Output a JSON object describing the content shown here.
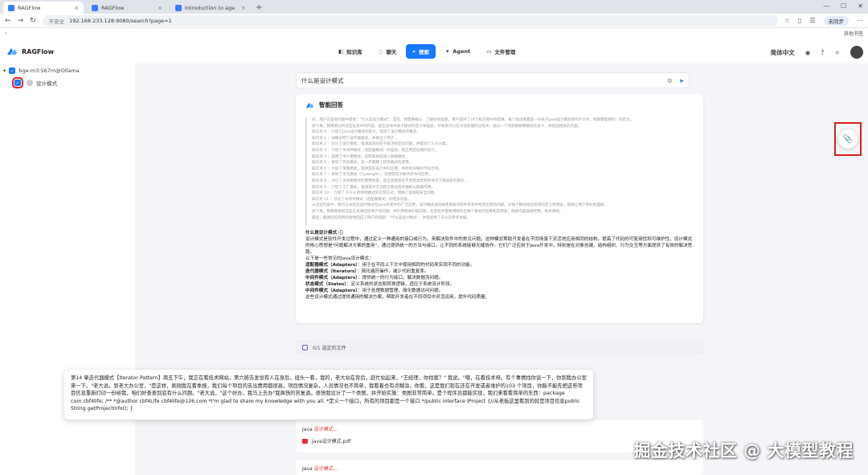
{
  "browser": {
    "tabs": [
      {
        "label": "RAGFlow",
        "active": true
      },
      {
        "label": "RAGFlow",
        "active": false
      },
      {
        "label": "Introduction to age",
        "active": false
      }
    ],
    "new_tab": "+",
    "url_warning": "不安全",
    "url": "192.168.233.128:9080/search?page=1",
    "profile_label": "未同步",
    "bookmarks_label": "其他书签"
  },
  "app": {
    "name": "RAGFlow",
    "nav": [
      {
        "label": "知识库",
        "active": false
      },
      {
        "label": "聊天",
        "active": false
      },
      {
        "label": "搜索",
        "active": true
      },
      {
        "label": "Agent",
        "active": false
      },
      {
        "label": "文件管理",
        "active": false
      }
    ],
    "language": "简体中文"
  },
  "sidebar": {
    "kb_label": "bge-m3:567m@Ollama",
    "doc_label": "设计模式"
  },
  "search": {
    "query": "什么是设计模式"
  },
  "answer": {
    "title": "智能回答",
    "thinking": [
      "好，用户在查询问题中提到：\"什么是设计模式\"。首先，我需要确认 · 了解好的指南。用户提供了24个知识库中的结果，每个知识库都是一份关于Java设计模式的PDF文件，标题都是相同 · 的结论。",
      "接下来，我需要分析这些信息中的内容，提出总体中关于模式的定义和描述。开发者可以在对话处理的过程中，通过一个问题来解释模式的含义，并给出相关的内容。",
      "知识点 0 ：介绍了Java设计模式的定义，提到了设计模式的概念。",
      "知识点 1 ：详细说明了迭代器模式，并举出了例子 。",
      "知识点 2 ：讨论了设计模式，强调其目的在于解决特定的问题，并提到了三大分类。",
      "知识点 3 ：介绍了中间件模式（适配器模式）的描述，其应用是后期的设计。",
      "知识点 4 ：说明了中介者模式，说明其如何减少依赖耦合。",
      "知识点 5 ：讲述了状态模式，说一步解释了状态模式的使用。",
      "知识点 6 ：介绍了策略模式，提供其在设计中的应用，并附有详细的代码示例。",
      "知识点 7 ：讲到了享元模式（Flyweight），说明其在对象共享中的应用 。",
      "知识点 8 ：讨论了访问者模式的使用场景，提出其能够在不改变类结构的情况下增加新的操作 。",
      "知识点 9 ：介绍了工厂模式，强调其对于创建对象过程的抽象与解耦作用。",
      "知识点 10 ：介绍了 0-0-0 的单例模式的实现方式，明确了其线程安全问题。",
      "知识点 11 ：讨论了中间件模式（适配器模式）的相关内容。",
      "从这些内容中，我可以总结出设计模式在Java开发中的广泛应用，设计模式通常被用来解决软件开发中经常出现的问题。对每个模式给出简单的定义和用途，能够让用户更好地理解。",
      "接下来，我需要组织这些信息来回答用户的问题，并引用相关的知识库。在回答中需要明确列出每个模式的名称和其用途，确保内容准确完整，格式清晰。",
      "最后，确保回答简明扼要地回应了用户的问题：\"什么是设计模式\"，并且提供了充分的参考依据。"
    ],
    "heading": "什么是设计模式",
    "intro": "设计模式是软件开发过程中，通过定义一种通用的接口或行为，来解决软件中的常见问题。这种模式帮助开发者在不同场景下灵活地应用相同的结构，提高了代码的可复用性和可维护性。设计模式的核心思想是\"问题解决方案的重用\"，通过提供统一的方法与接口，让不同的系统能够无缝协作。它们广泛应用于Java开发中，特别是在对象创建、结构组织、行为交互等方面提供了有效的解决思路。",
    "list_intro": "以下是一些常见的Java设计模式：",
    "items": [
      {
        "name": "适配器模式（Adapters）",
        "desc": "：用于在不同上下文中使用相同的代码来实现不同的功能。"
      },
      {
        "name": "迭代器模式（Iterators）",
        "desc": "：简化遍历操作，减少代码重复率。"
      },
      {
        "name": "中间件模式（Adapters）",
        "desc": "：提供统一的行为接口，解决数据流问题。"
      },
      {
        "name": "状态模式（States）",
        "desc": "：定义系统的状态和转换逻辑，适应于系统设计阶段。"
      },
      {
        "name": "中间件模式（Adapters）",
        "desc": "：用于处理数据管理，简化数据访问问题。"
      }
    ],
    "summary": "这些设计模式通过提供通用的解决方案，帮助开发者在不同项目中灵活运用，提升代码质量。"
  },
  "files_bar": {
    "label": "0/1 选定的文件"
  },
  "popup": {
    "text": "第14 章迭代器模式【Iterator Pattern】周五下午，我正在看技术网站，第六感告发觉有人在身后，扭头一看，我的，老大站在背后，赶忙站起来，\"王经理，你找我？\" 我说。\"哦，在看技术呀。有个事情找你谈一下，你到我办公室来一下。\"老大说。到老大办公室，\"是这样，刚刚我在看季报，我们每个项目的支出费用都很高，项目情况复杂，人员情况也不简单，我看着也有点糊涂，你看，这是我们现在还在开发或者维护的103 个项目，你能不能先把这些项目信息重新打印一份给我，咱们好查查到底有什么问题。\"老大说。\"这个好办，我马上去办\"我爽快的答复道。很快我设计了一个类图，并开始实施：类图非常简单，是个程序员都能实现，我们来看看简单的东西：package com.cbf4life; /** *@author cbf4Life cbf4life@126.com *I'm glad to share my knowledge with you all. *定义一个接口，所有的项目都是一个接口 */public interface IProject {//从老板这里看到的就是项目信息public String getProjectInfo(); }"
  },
  "cards": [
    {
      "source": "Java",
      "keyword": "设计模式...",
      "file": "Java设计模式.pdf"
    },
    {
      "source": "Java",
      "keyword": "设计模式...",
      "file": ""
    }
  ],
  "watermark": "掘金技术社区 @ 大模型教程",
  "colors": {
    "accent": "#1677ff",
    "highlight": "#e02020",
    "keyword": "#dd3333"
  },
  "icons": [
    "paperclip-icon",
    "send-icon",
    "gear-icon",
    "github-icon",
    "help-icon",
    "sun-icon"
  ]
}
